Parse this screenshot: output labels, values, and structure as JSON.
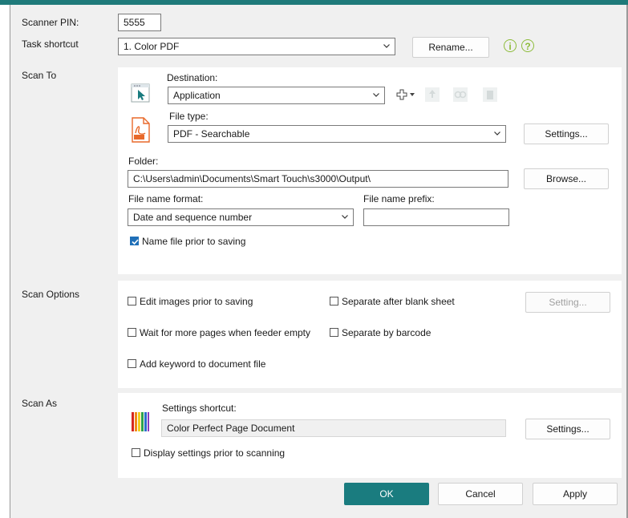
{
  "labels": {
    "scanner_pin": "Scanner PIN:",
    "task_shortcut": "Task shortcut",
    "scan_to": "Scan To",
    "scan_options": "Scan Options",
    "scan_as": "Scan As"
  },
  "scanner_pin_value": "5555",
  "task_shortcut": {
    "selected": "1. Color PDF",
    "rename_label": "Rename...",
    "info_glyph": "i",
    "help_glyph": "?"
  },
  "scan_to": {
    "destination_label": "Destination:",
    "destination_value": "Application",
    "add_glyph": "+",
    "file_type_label": "File type:",
    "file_type_value": "PDF - Searchable",
    "settings_label": "Settings...",
    "folder_label": "Folder:",
    "folder_value": "C:\\Users\\admin\\Documents\\Smart Touch\\s3000\\Output\\",
    "browse_label": "Browse...",
    "file_name_format_label": "File name format:",
    "file_name_format_value": "Date and sequence number",
    "file_name_prefix_label": "File name prefix:",
    "file_name_prefix_value": "",
    "name_prior_label": "Name file prior to saving",
    "name_prior_checked": true
  },
  "scan_options": {
    "edit_images": {
      "label": "Edit images prior to saving",
      "checked": false
    },
    "wait_more_pages": {
      "label": "Wait for more pages when feeder empty",
      "checked": false
    },
    "add_keyword": {
      "label": "Add keyword to document file",
      "checked": false
    },
    "separate_blank": {
      "label": "Separate after blank sheet",
      "checked": false
    },
    "separate_barcode": {
      "label": "Separate by barcode",
      "checked": false
    },
    "setting_label": "Setting..."
  },
  "scan_as": {
    "settings_shortcut_label": "Settings shortcut:",
    "settings_shortcut_value": "Color Perfect Page Document",
    "settings_label": "Settings...",
    "display_settings_label": "Display settings prior to scanning",
    "display_settings_checked": false
  },
  "footer": {
    "ok_label": "OK",
    "cancel_label": "Cancel",
    "apply_label": "Apply"
  },
  "colors": {
    "accent": "#1a7c7f",
    "checkbox_checked": "#1f6fb8",
    "help_icon": "#8dbb3a",
    "pdf_icon": "#e8692a"
  },
  "icons": {
    "application": "cursor-window-icon",
    "file_type": "pdf-icon",
    "color_bars": "color-bars-icon",
    "add": "add-destination-icon"
  }
}
